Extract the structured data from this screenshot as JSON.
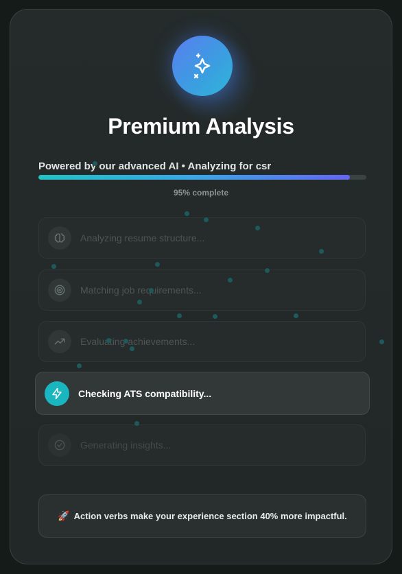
{
  "header": {
    "title": "Premium Analysis",
    "subtitle": "Powered by our advanced AI • Analyzing for csr",
    "logo_icon": "sparkle-icon"
  },
  "progress": {
    "value": 95,
    "label": "95% complete"
  },
  "steps": [
    {
      "label": "Analyzing resume structure...",
      "icon": "brain-icon",
      "state": "pending"
    },
    {
      "label": "Matching job requirements...",
      "icon": "target-icon",
      "state": "pending"
    },
    {
      "label": "Evaluating achievements...",
      "icon": "trending-up-icon",
      "state": "pending"
    },
    {
      "label": "Checking ATS compatibility...",
      "icon": "lightning-icon",
      "state": "active"
    },
    {
      "label": "Generating insights...",
      "icon": "check-circle-icon",
      "state": "pending"
    }
  ],
  "tip": {
    "icon": "rocket-icon",
    "text": "Action verbs make your experience section 40% more impactful."
  },
  "colors": {
    "accent_teal": "#19b6c0",
    "accent_blue": "#5a7df0",
    "background": "#151b19",
    "card": "#252b2b"
  }
}
